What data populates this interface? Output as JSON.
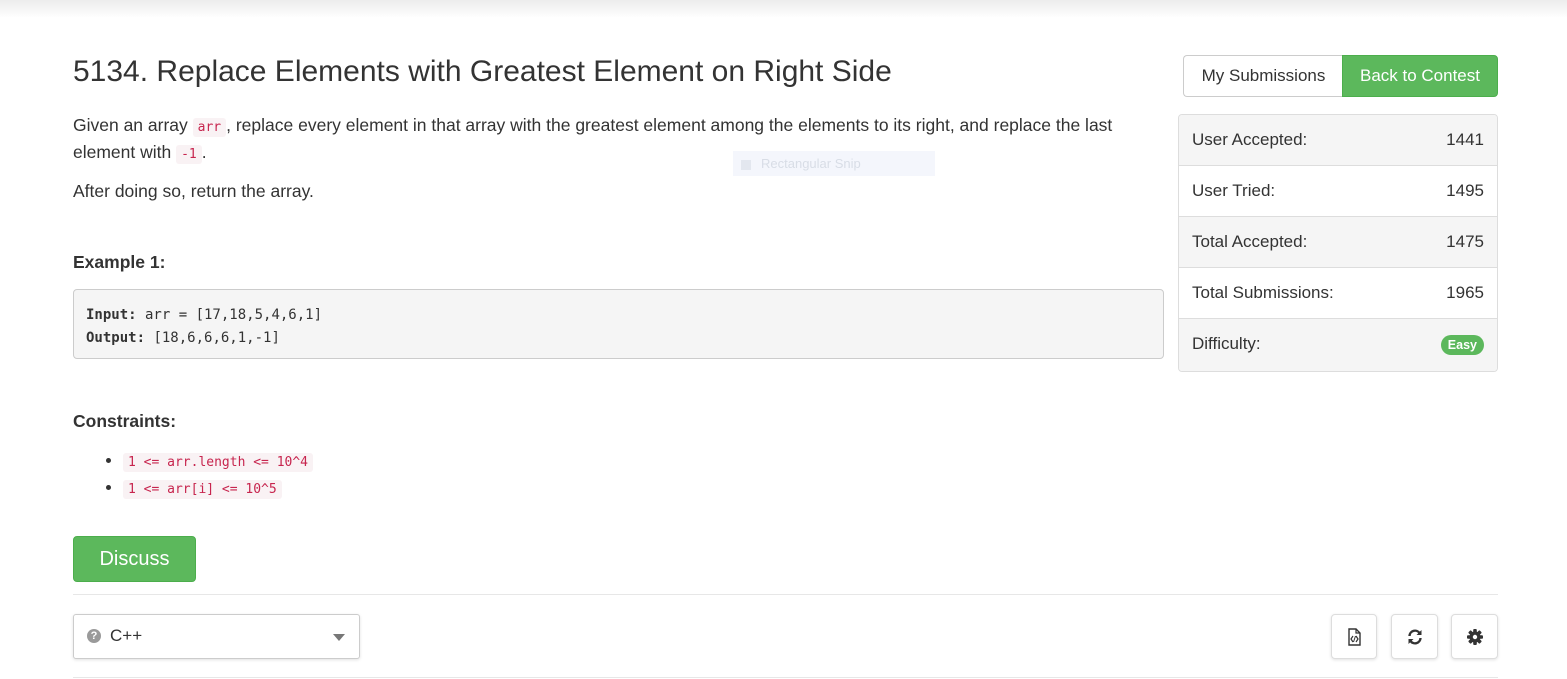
{
  "problem": {
    "title": "5134. Replace Elements with Greatest Element on Right Side",
    "desc_part1": "Given an array ",
    "desc_code1": "arr",
    "desc_part2": ", replace every element in that array with the greatest element among the elements to its right, and replace the last element with ",
    "desc_code2": "-1",
    "desc_part3": ".",
    "desc_para2": "After doing so, return the array."
  },
  "example": {
    "heading": "Example 1:",
    "input_label": "Input:",
    "input_value": " arr = [17,18,5,4,6,1]",
    "output_label": "Output:",
    "output_value": " [18,6,6,6,1,-1]"
  },
  "constraints": {
    "heading": "Constraints:",
    "items": [
      "1 <= arr.length <= 10^4",
      "1 <= arr[i] <= 10^5"
    ]
  },
  "actions": {
    "discuss_label": "Discuss",
    "my_submissions_label": "My Submissions",
    "back_to_contest_label": "Back to Contest"
  },
  "stats": [
    {
      "label": "User Accepted:",
      "value": "1441"
    },
    {
      "label": "User Tried:",
      "value": "1495"
    },
    {
      "label": "Total Accepted:",
      "value": "1475"
    },
    {
      "label": "Total Submissions:",
      "value": "1965"
    },
    {
      "label": "Difficulty:",
      "value": "Easy"
    }
  ],
  "editor": {
    "language": "C++",
    "help_icon": "question-circle-icon",
    "tools": [
      "file-code-icon",
      "refresh-icon",
      "gear-icon"
    ]
  },
  "overlay": {
    "snip_label": "Rectangular Snip"
  },
  "colors": {
    "green": "#5cb85c",
    "code_pink": "#c7254e",
    "code_bg": "#f9f2f4"
  }
}
